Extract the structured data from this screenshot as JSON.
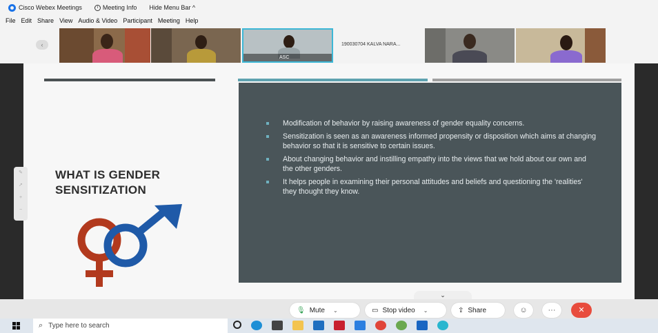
{
  "titlebar": {
    "app": "Cisco Webex Meetings",
    "meeting_info": "Meeting Info",
    "hide_menu": "Hide Menu Bar ^"
  },
  "menu": [
    "File",
    "Edit",
    "Share",
    "View",
    "Audio & Video",
    "Participant",
    "Meeting",
    "Help"
  ],
  "participants": {
    "active_label": "ASC",
    "named_tile": "190030704 KALVA NARA..."
  },
  "slide": {
    "ghost_text": "",
    "heading": "WHAT IS GENDER SENSITIZATION",
    "bullets": [
      "Modification of behavior by raising awareness of gender equality concerns.",
      " Sensitization is seen as an awareness informed propensity or disposition which aims at changing behavior so that it is sensitive to certain issues.",
      "About changing behavior and instilling empathy into the views that we hold about our own and the other genders.",
      "It helps people in examining their personal attitudes and beliefs and questioning the 'realities' they thought they know."
    ]
  },
  "controls": {
    "mute": "Mute",
    "stop_video": "Stop video",
    "share": "Share",
    "more": "···",
    "collapse": "⌄"
  },
  "taskbar": {
    "search_placeholder": "Type here to search"
  },
  "colors": {
    "panel": "#4a5559",
    "accent": "#6fb1bf",
    "end_call": "#e84c3d",
    "female_symbol": "#b23a1e",
    "male_symbol": "#1f5aa8"
  }
}
